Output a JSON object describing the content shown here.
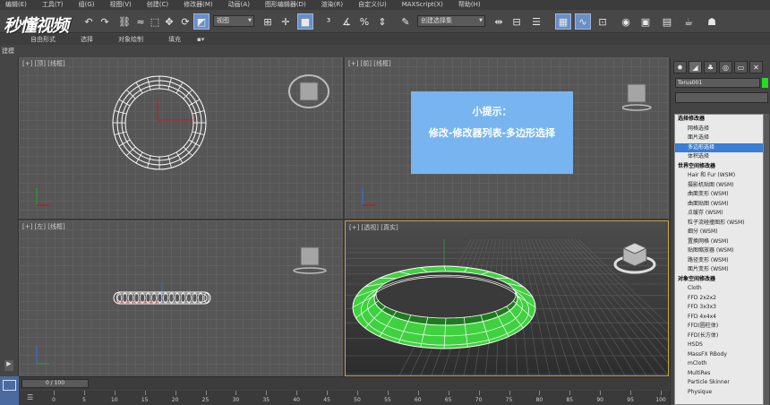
{
  "menu": [
    "编辑(E)",
    "工具(T)",
    "组(G)",
    "视图(V)",
    "创建(C)",
    "修改器(M)",
    "动画(A)",
    "图形编辑器(D)",
    "渲染(R)",
    "自定义(U)",
    "MAXScript(X)",
    "帮助(H)"
  ],
  "logo": "秒懂视频",
  "toolbar": {
    "view_select": "视图",
    "selection_set": "创建选择集"
  },
  "ribbon": {
    "tabs": [
      "自由形式",
      "选择",
      "对象绘制",
      "填充"
    ],
    "sub_label": "建模"
  },
  "viewports": {
    "top": "[+] [顶] [线框]",
    "front": "[+] [前] [线框]",
    "left": "[+] [左] [线框]",
    "persp": "[+] [透视] [真实]"
  },
  "tip": {
    "title": "小提示：",
    "body": "修改-修改器列表-多边形选择"
  },
  "command_panel": {
    "object_name": "Torus001",
    "object_color": "#22dd22",
    "modifier_list": [
      {
        "label": "选择修改器",
        "type": "header"
      },
      {
        "label": "网格选择",
        "type": "item"
      },
      {
        "label": "面片选择",
        "type": "item"
      },
      {
        "label": "多边形选择",
        "type": "selected"
      },
      {
        "label": "体积选择",
        "type": "item"
      },
      {
        "label": "世界空间修改器",
        "type": "header"
      },
      {
        "label": "Hair 和 Fur (WSM)",
        "type": "item"
      },
      {
        "label": "摄影机贴图 (WSM)",
        "type": "item"
      },
      {
        "label": "曲面变形 (WSM)",
        "type": "item"
      },
      {
        "label": "曲面贴图 (WSM)",
        "type": "item"
      },
      {
        "label": "点缓存 (WSM)",
        "type": "item"
      },
      {
        "label": "粒子流碰撞图形 (WSM)",
        "type": "item"
      },
      {
        "label": "细分 (WSM)",
        "type": "item"
      },
      {
        "label": "置换网格 (WSM)",
        "type": "item"
      },
      {
        "label": "贴图缩放器 (WSM)",
        "type": "item"
      },
      {
        "label": "路径变形 (WSM)",
        "type": "item"
      },
      {
        "label": "面片变形 (WSM)",
        "type": "item"
      },
      {
        "label": "对象空间修改器",
        "type": "header"
      },
      {
        "label": "Cloth",
        "type": "item"
      },
      {
        "label": "FFD 2x2x2",
        "type": "item"
      },
      {
        "label": "FFD 3x3x3",
        "type": "item"
      },
      {
        "label": "FFD 4x4x4",
        "type": "item"
      },
      {
        "label": "FFD(圆柱体)",
        "type": "item"
      },
      {
        "label": "FFD(长方体)",
        "type": "item"
      },
      {
        "label": "HSDS",
        "type": "item"
      },
      {
        "label": "MassFX RBody",
        "type": "item"
      },
      {
        "label": "mCloth",
        "type": "item"
      },
      {
        "label": "MultiRes",
        "type": "item"
      },
      {
        "label": "Particle Skinner",
        "type": "item"
      },
      {
        "label": "Physique",
        "type": "item"
      }
    ]
  },
  "timeline": {
    "slider": "0 / 100",
    "ticks": [
      0,
      5,
      10,
      15,
      20,
      25,
      30,
      35,
      40,
      45,
      50,
      55,
      60,
      65,
      70,
      75,
      80,
      85,
      90,
      95,
      100
    ]
  }
}
